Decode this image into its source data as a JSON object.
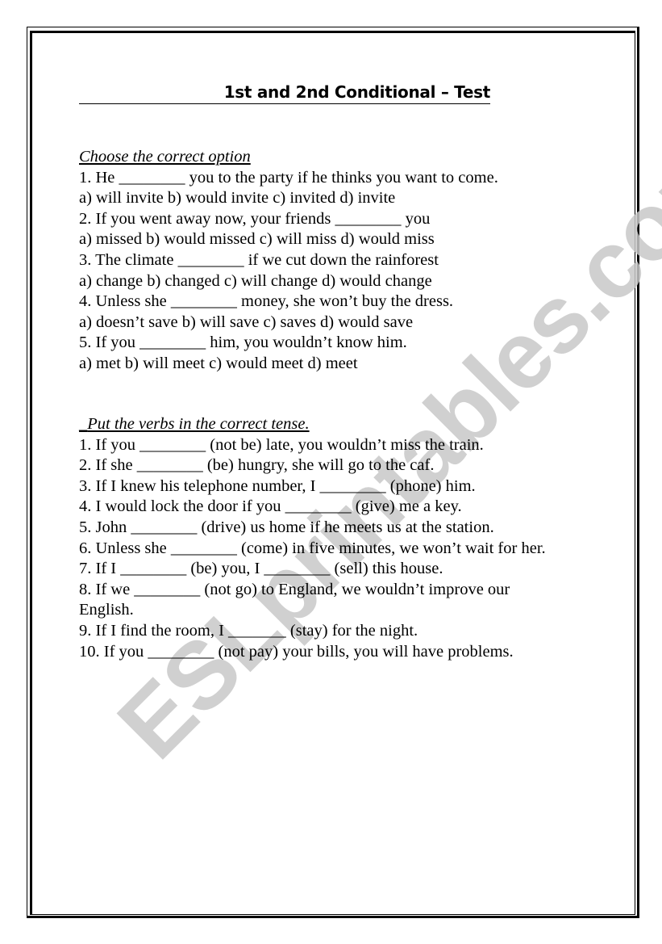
{
  "title": "1st and 2nd Conditional – Test",
  "watermark": "ESLprintables.com",
  "section1": {
    "heading": "Choose the correct option",
    "items": [
      {
        "question": "1. He ________ you to the party if he thinks you want to come.",
        "options": "a) will invite b) would invite c) invited d) invite"
      },
      {
        "question": "2. If you went away now, your friends ________ you",
        "options": "a) missed b) would missed c) will miss d) would miss"
      },
      {
        "question": "3. The climate ________ if we cut down the rainforest",
        "options": "a) change b) changed c) will change d) would change"
      },
      {
        "question": "4. Unless she ________ money, she won’t buy the dress.",
        "options": "a) doesn’t save b) will save c) saves d) would save"
      },
      {
        "question": "5. If you ________ him, you wouldn’t know him.",
        "options": "a) met b) will meet c) would meet d) meet"
      }
    ]
  },
  "section2": {
    "heading": "Put the verbs in the correct tense.",
    "heading_prefix": "_",
    "items": [
      "1. If you ________ (not be) late, you wouldn’t miss the train.",
      "2. If she ________ (be) hungry, she will go to the caf.",
      "3. If I knew his telephone number, I ________ (phone) him.",
      "4. I would lock the door if you ________ (give) me a key.",
      "5. John ________ (drive) us home if he meets us at the station.",
      "6. Unless she ________ (come) in five minutes, we won’t wait for her.",
      "7. If I ________ (be) you, I ________ (sell) this house.",
      "8. If we ________ (not go) to England, we wouldn’t improve our",
      "English.",
      "9. If I find the room, I _______ (stay) for the night.",
      "10. If you ________ (not pay) your bills, you will have problems."
    ]
  }
}
